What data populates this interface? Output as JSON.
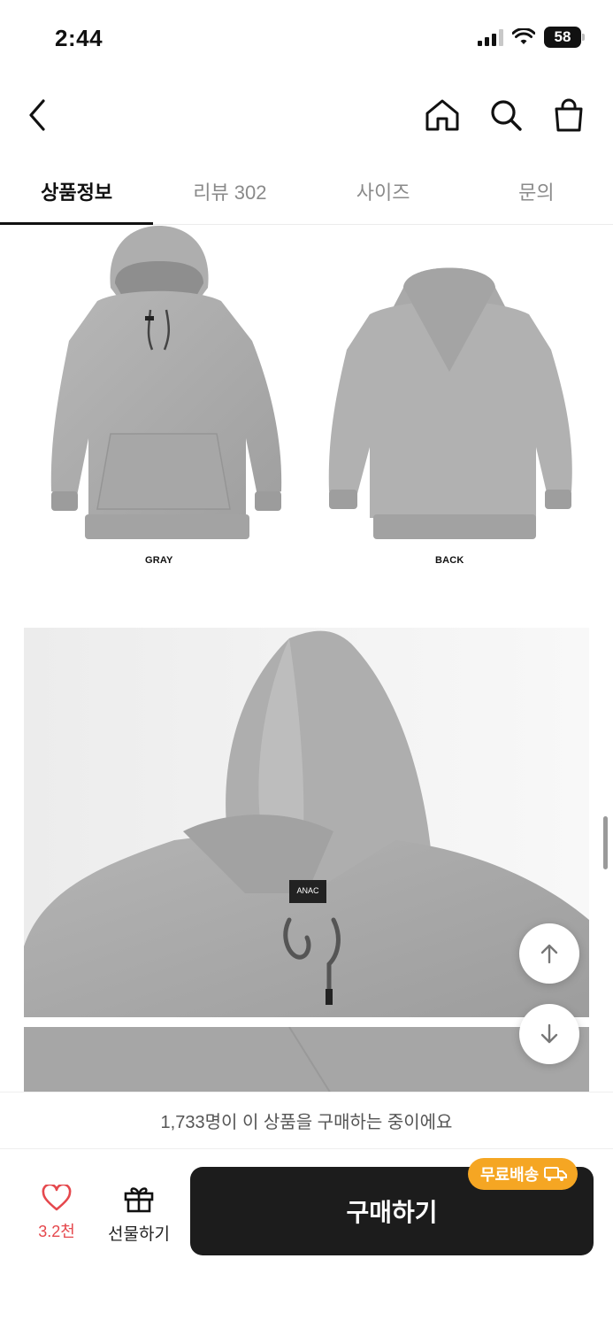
{
  "status_bar": {
    "time": "2:44",
    "battery": "58"
  },
  "colors": {
    "accent_like": "#e5484d",
    "buy_button": "#1c1c1c",
    "free_shipping_badge": "#f5a623"
  },
  "nav": {
    "back_icon": "chevron-left-icon",
    "home_icon": "home-icon",
    "search_icon": "search-icon",
    "cart_icon": "shopping-bag-icon"
  },
  "tabs": [
    {
      "label": "상품정보",
      "active": true
    },
    {
      "label": "리뷰 302",
      "active": false
    },
    {
      "label": "사이즈",
      "active": false
    },
    {
      "label": "문의",
      "active": false
    }
  ],
  "product_images": {
    "front_label": "GRAY",
    "back_label": "BACK",
    "closeup_tag": "ANAC"
  },
  "floating": {
    "up_icon": "arrow-up-icon",
    "down_icon": "arrow-down-icon"
  },
  "notice": {
    "text": "1,733명이 이 상품을 구매하는 중이에요"
  },
  "bottom_bar": {
    "like_count": "3.2천",
    "gift_label": "선물하기",
    "buy_label": "구매하기",
    "free_shipping": "무료배송"
  }
}
